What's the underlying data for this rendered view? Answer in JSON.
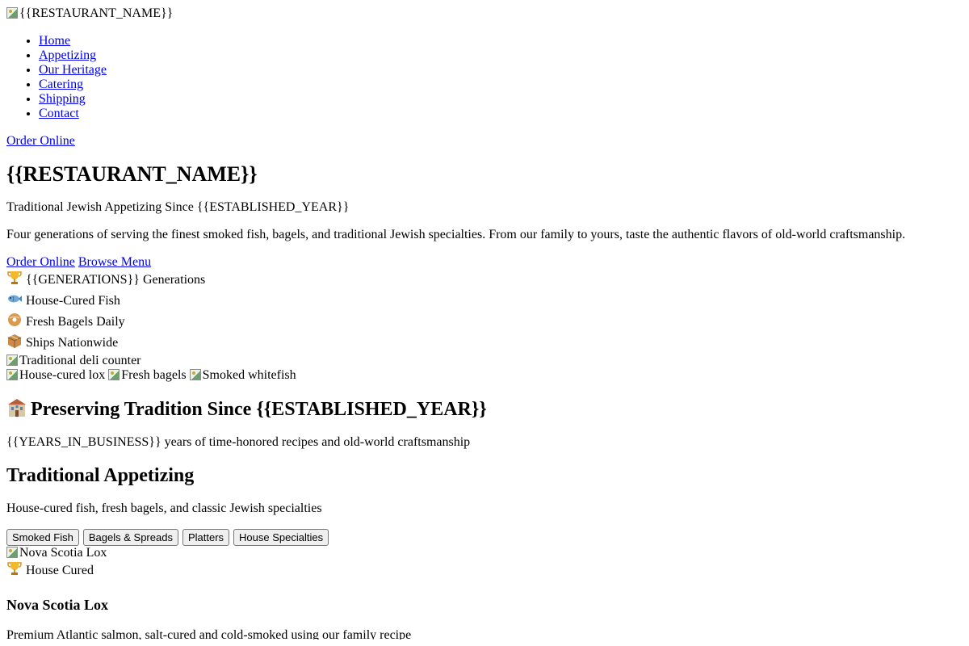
{
  "header": {
    "logo_alt": "{{RESTAURANT_NAME}}",
    "nav": [
      {
        "label": "Home"
      },
      {
        "label": "Appetizing"
      },
      {
        "label": "Our Heritage"
      },
      {
        "label": "Catering"
      },
      {
        "label": "Shipping"
      },
      {
        "label": "Contact"
      }
    ],
    "order_online": "Order Online"
  },
  "hero": {
    "title": "{{RESTAURANT_NAME}}",
    "tagline": "Traditional Jewish Appetizing Since {{ESTABLISHED_YEAR}}",
    "description": "Four generations of serving the finest smoked fish, bagels, and traditional Jewish specialties. From our family to yours, taste the authentic flavors of old-world craftsmanship.",
    "primary_cta": "Order Online",
    "secondary_cta": "Browse Menu",
    "badges": [
      {
        "icon": "trophy-icon",
        "text": "{{GENERATIONS}} Generations"
      },
      {
        "icon": "fish-icon",
        "text": "House-Cured Fish"
      },
      {
        "icon": "bagel-icon",
        "text": "Fresh Bagels Daily"
      },
      {
        "icon": "package-icon",
        "text": "Ships Nationwide"
      }
    ],
    "main_image_alt": "Traditional deli counter",
    "thumb_images": [
      "House-cured lox",
      "Fresh bagels",
      "Smoked whitefish"
    ]
  },
  "heritage": {
    "icon": "building-icon",
    "title": "Preserving Tradition Since {{ESTABLISHED_YEAR}}",
    "subtitle": "{{YEARS_IN_BUSINESS}} years of time-honored recipes and old-world craftsmanship"
  },
  "menu": {
    "title": "Traditional Appetizing",
    "subtitle": "House-cured fish, fresh bagels, and classic Jewish specialties",
    "tabs": [
      "Smoked Fish",
      "Bagels & Spreads",
      "Platters",
      "House Specialties"
    ],
    "item": {
      "image_alt": "Nova Scotia Lox",
      "badge_icon": "trophy-icon",
      "badge": "House Cured",
      "name": "Nova Scotia Lox",
      "description": "Premium Atlantic salmon, salt-cured and cold-smoked using our family recipe"
    }
  },
  "colors": {
    "link": "#0000ee",
    "text": "#000000",
    "button_bg": "#efefef"
  }
}
